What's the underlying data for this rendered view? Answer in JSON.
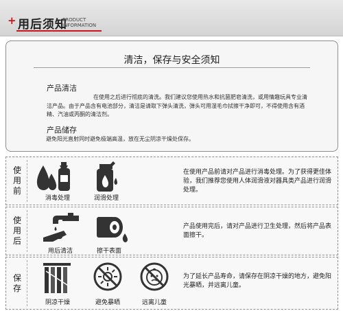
{
  "header": {
    "title": "用后须知",
    "sub_line1": "PRODUCT",
    "sub_line2": "INFORMATION"
  },
  "card": {
    "title": "清洁，保存与安全须知",
    "clean_heading": "产品清洁",
    "clean_text": "在使用之后进行彻底的清洗。我们建议您使用热水和抗菌肥皂清洗，或用情趣玩具专业清洁产品。由于产品含有电池部分，清洁是请取下弹头清洗，弹头可用湿毛巾拭擦干净即可，不得使用含有酒精、汽油或丙酮的清洁剂。",
    "store_heading": "产品储存",
    "store_text": "避免阳光直射同时避免极端高温，放在无尘阴凉干燥处保存。"
  },
  "rows": [
    {
      "label": "使用前",
      "cap1": "消毒处理",
      "cap2": "润滑处理",
      "text": "在使用产品前请对产品进行消毒处理。为了获得更佳体验，我们推荐您使用人体润滑液对器具类产品进行润滑处理。"
    },
    {
      "label": "使用后",
      "cap1": "用后清洁",
      "cap2": "擦干表面",
      "text": "产品使用完后，请对产品进行卫生处理，然后将产品表面擦干。"
    },
    {
      "label": "保存",
      "cap1": "阴凉干燥",
      "cap2": "避免暴晒",
      "cap3": "远离儿童",
      "text": "为了延长产品寿命，请保存在阴凉干燥的地方，避免阳光暴晒，并远离儿童。"
    }
  ]
}
